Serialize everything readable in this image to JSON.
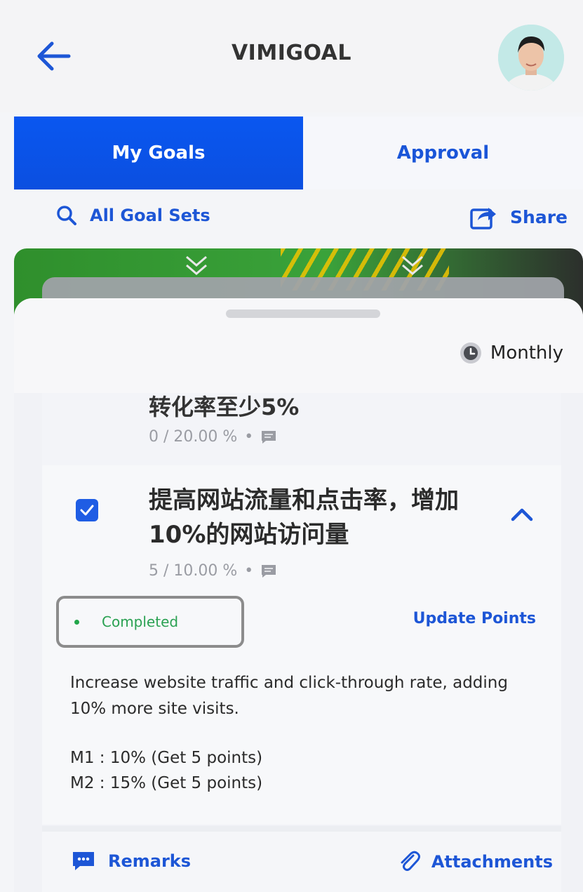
{
  "header": {
    "title": "VIMIGOAL"
  },
  "tabs": [
    {
      "label": "My Goals",
      "active": true
    },
    {
      "label": "Approval",
      "active": false
    }
  ],
  "toolbar": {
    "all_goal_sets_label": "All Goal Sets",
    "share_label": "Share"
  },
  "sheet": {
    "period_label": "Monthly"
  },
  "previous_goal": {
    "title": "转化率至少5%",
    "progress": "0 / 20.00 %"
  },
  "goal": {
    "title": "提高网站流量和点击率，增加10%的网站访问量",
    "progress": "5 / 10.00 %",
    "checked": true,
    "status": "Completed",
    "update_points_label": "Update Points",
    "description": "Increase website traffic and click-through rate, adding 10% more site visits.",
    "milestones": [
      "M1 : 10% (Get 5 points)",
      "M2 : 15% (Get 5 points)"
    ]
  },
  "footer": {
    "remarks_label": "Remarks",
    "attachments_label": "Attachments"
  },
  "colors": {
    "primary": "#0a57f0",
    "link": "#1d56d6",
    "success": "#22a64a"
  },
  "icons": [
    "back-arrow-icon",
    "avatar-image",
    "search-icon",
    "share-icon",
    "clock-icon",
    "comment-icon",
    "checkbox-checked-icon",
    "chevron-up-icon",
    "chat-icon",
    "paperclip-icon"
  ]
}
